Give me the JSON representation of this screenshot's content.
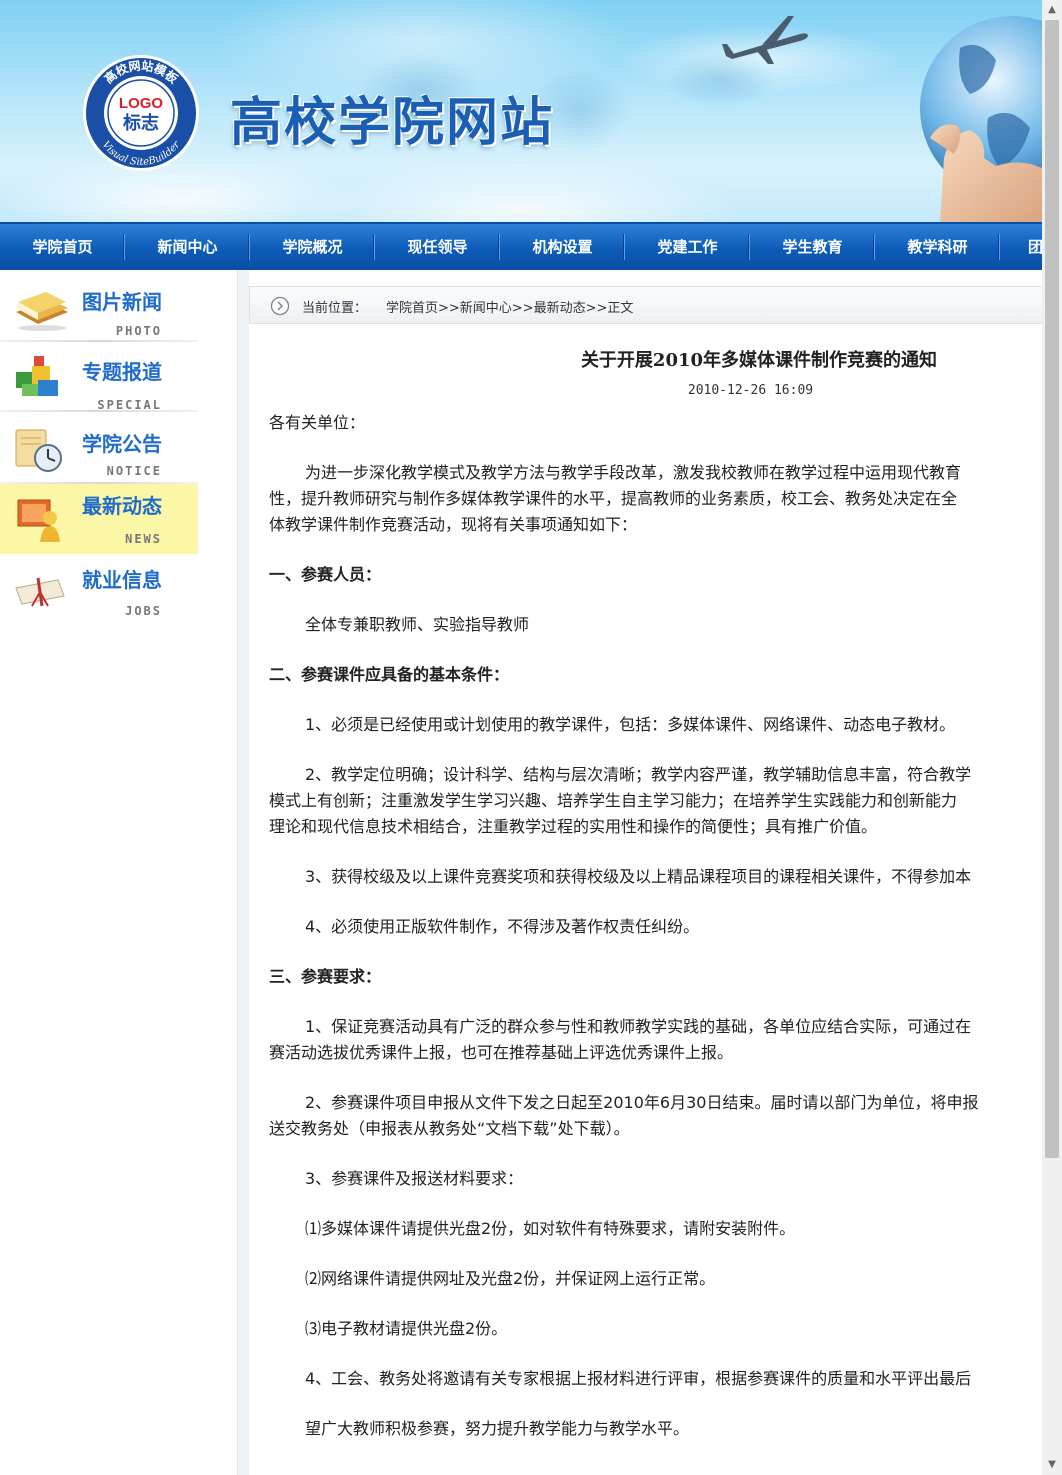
{
  "banner": {
    "site_title": "高校学院网站",
    "logo_text": "LOGO",
    "logo_sub": "标志",
    "logo_ring_top": "高校网站模板",
    "logo_ring_bottom": "Visual SiteBuilder"
  },
  "nav": {
    "items": [
      "学院首页",
      "新闻中心",
      "学院概况",
      "现任领导",
      "机构设置",
      "党建工作",
      "学生教育",
      "教学科研",
      "团"
    ]
  },
  "sidebar": {
    "items": [
      {
        "zh": "图片新闻",
        "en": "PHOTO",
        "icon": "books-icon"
      },
      {
        "zh": "专题报道",
        "en": "SPECIAL",
        "icon": "blocks-icon"
      },
      {
        "zh": "学院公告",
        "en": "NOTICE",
        "icon": "clock-notice-icon"
      },
      {
        "zh": "最新动态",
        "en": "NEWS",
        "icon": "person-board-icon"
      },
      {
        "zh": "就业信息",
        "en": "JOBS",
        "icon": "diploma-icon"
      }
    ],
    "active_index": 3
  },
  "breadcrumb": {
    "label": "当前位置：",
    "path": "学院首页>>新闻中心>>最新动态>>正文"
  },
  "article": {
    "title": "关于开展2010年多媒体课件制作竞赛的通知",
    "date": "2010-12-26 16:09",
    "salutation": "各有关单位：",
    "intro_1": "为进一步深化教学模式及教学方法与教学手段改革，激发我校教师在教学过程中运用现代教育",
    "intro_2": "性，提升教师研究与制作多媒体教学课件的水平，提高教师的业务素质，校工会、教务处决定在全",
    "intro_3": "体教学课件制作竞赛活动，现将有关事项通知如下：",
    "h1": "一、参赛人员：",
    "p1": "全体专兼职教师、实验指导教师",
    "h2": "二、参赛课件应具备的基本条件：",
    "c1": "1、必须是已经使用或计划使用的教学课件，包括：多媒体课件、网络课件、动态电子教材。",
    "c2_1": "2、教学定位明确；设计科学、结构与层次清晰；教学内容严谨，教学辅助信息丰富，符合教学",
    "c2_2": "模式上有创新；注重激发学生学习兴趣、培养学生自主学习能力；在培养学生实践能力和创新能力",
    "c2_3": "理论和现代信息技术相结合，注重教学过程的实用性和操作的简便性；具有推广价值。",
    "c3": "3、获得校级及以上课件竞赛奖项和获得校级及以上精品课程项目的课程相关课件，不得参加本",
    "c4": "4、必须使用正版软件制作，不得涉及著作权责任纠纷。",
    "h3": "三、参赛要求：",
    "r1_1": "1、保证竞赛活动具有广泛的群众参与性和教师教学实践的基础，各单位应结合实际，可通过在",
    "r1_2": "赛活动选拔优秀课件上报，也可在推荐基础上评选优秀课件上报。",
    "r2_1": "2、参赛课件项目申报从文件下发之日起至2010年6月30日结束。届时请以部门为单位，将申报",
    "r2_2": "送交教务处（申报表从教务处“文档下载”处下载）。",
    "r3": "3、参赛课件及报送材料要求：",
    "r3_a": "⑴多媒体课件请提供光盘2份，如对软件有特殊要求，请附安装附件。",
    "r3_b": "⑵网络课件请提供网址及光盘2份，并保证网上运行正常。",
    "r3_c": "⑶电子教材请提供光盘2份。",
    "r4": "4、工会、教务处将邀请有关专家根据上报材料进行评审，根据参赛课件的质量和水平评出最后",
    "closing": "望广大教师积极参赛，努力提升教学能力与教学水平。"
  },
  "colors": {
    "nav_bg": "#0d5cb8",
    "title_blue": "#1b5fb5",
    "side_active": "#fbf7a6",
    "side_text": "#1f6ccb"
  }
}
